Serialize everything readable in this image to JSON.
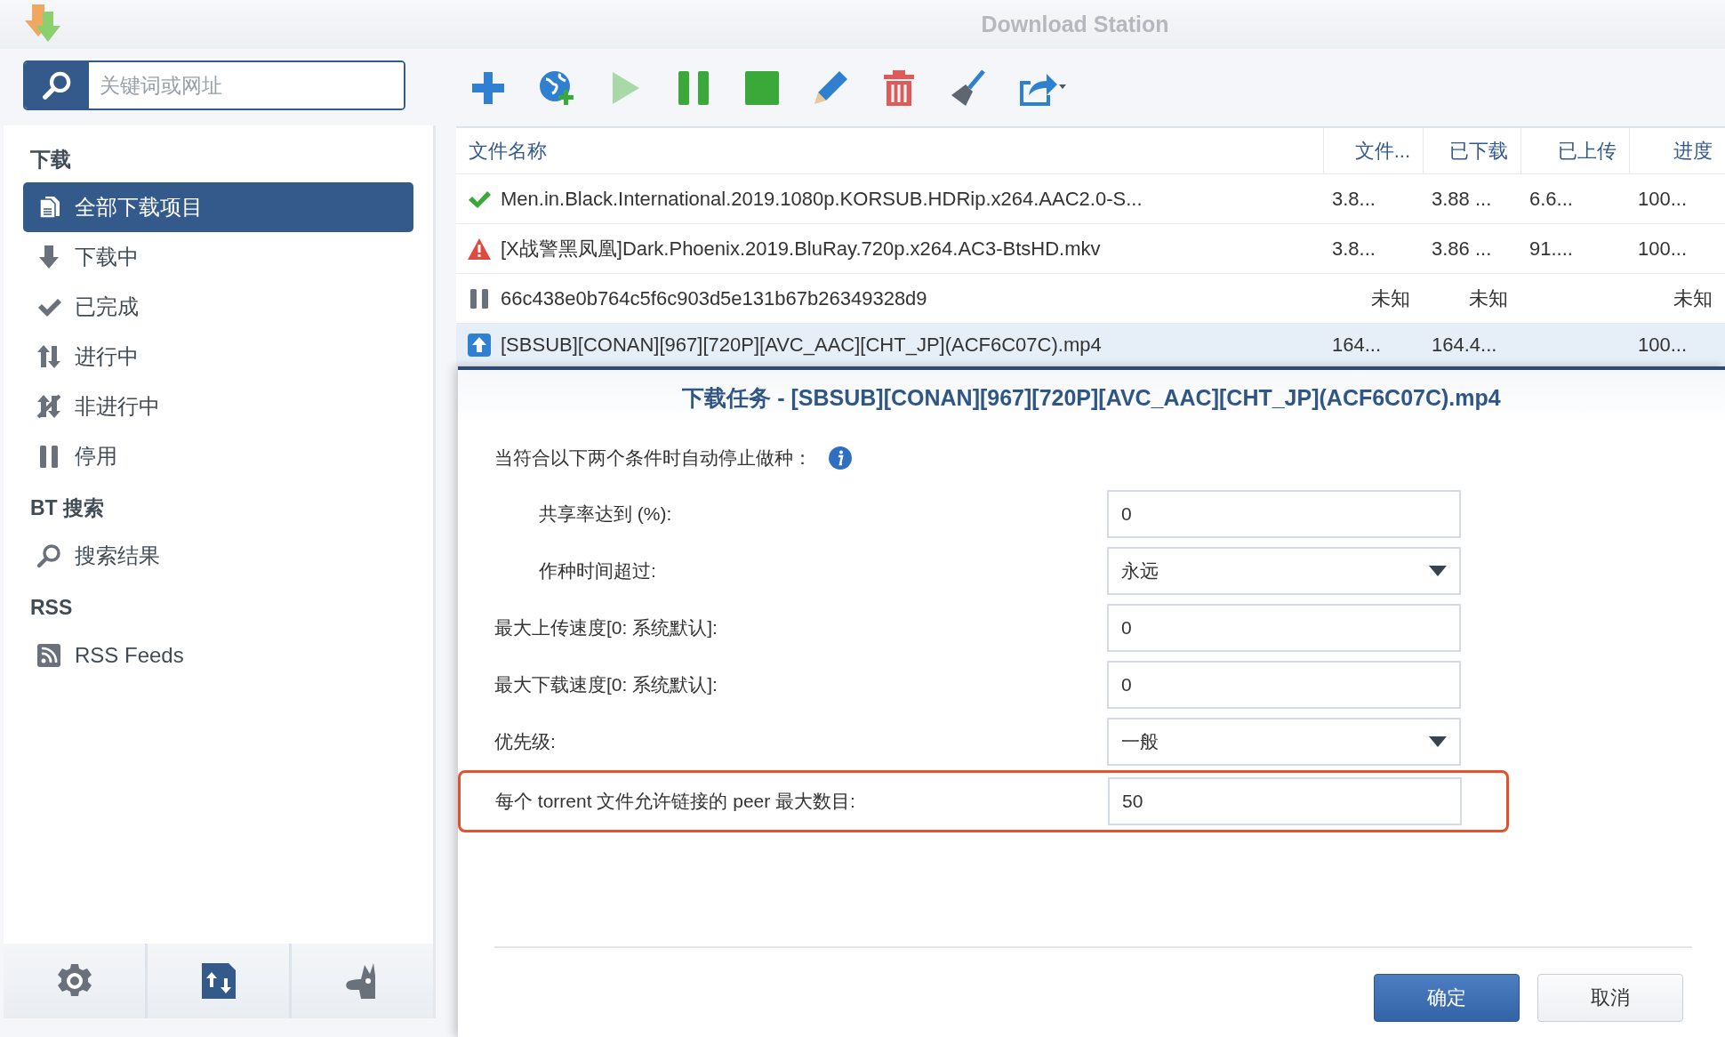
{
  "window": {
    "title": "Download Station"
  },
  "search": {
    "placeholder": "关键词或网址"
  },
  "sidebar": {
    "sections": [
      {
        "title": "下载",
        "items": [
          {
            "label": "全部下载项目",
            "kind": "all",
            "selected": true
          },
          {
            "label": "下载中",
            "kind": "downloading",
            "selected": false
          },
          {
            "label": "已完成",
            "kind": "completed",
            "selected": false
          },
          {
            "label": "进行中",
            "kind": "active",
            "selected": false
          },
          {
            "label": "非进行中",
            "kind": "inactive",
            "selected": false
          },
          {
            "label": "停用",
            "kind": "stopped",
            "selected": false
          }
        ]
      },
      {
        "title": "BT 搜索",
        "items": [
          {
            "label": "搜索结果",
            "kind": "search",
            "selected": false
          }
        ]
      },
      {
        "title": "RSS",
        "items": [
          {
            "label": "RSS Feeds",
            "kind": "rss",
            "selected": false
          }
        ]
      }
    ]
  },
  "toolbar": [
    {
      "kind": "add",
      "disabled": false
    },
    {
      "kind": "url",
      "disabled": false
    },
    {
      "kind": "play",
      "disabled": true
    },
    {
      "kind": "pause",
      "disabled": false
    },
    {
      "kind": "stop",
      "disabled": false
    },
    {
      "kind": "edit",
      "disabled": false
    },
    {
      "kind": "delete",
      "disabled": false
    },
    {
      "kind": "clean",
      "disabled": false
    },
    {
      "kind": "share",
      "disabled": false
    }
  ],
  "table": {
    "columns": [
      "文件名称",
      "文件...",
      "已下载",
      "已上传",
      "进度"
    ],
    "rows": [
      {
        "kind": "done",
        "name": "Men.in.Black.International.2019.1080p.KORSUB.HDRip.x264.AAC2.0-S...",
        "size": "3.8...",
        "downloaded": "3.88 ...",
        "uploaded": "6.6...",
        "progress": "100...",
        "selected": false
      },
      {
        "kind": "error",
        "name": "[X战警黑凤凰]Dark.Phoenix.2019.BluRay.720p.x264.AC3-BtsHD.mkv",
        "size": "3.8...",
        "downloaded": "3.86 ...",
        "uploaded": "91....",
        "progress": "100...",
        "selected": false
      },
      {
        "kind": "paused",
        "name": "66c438e0b764c5f6c903d5e131b67b26349328d9",
        "size": "未知",
        "downloaded": "未知",
        "progress": "未知",
        "selected": false
      },
      {
        "kind": "seeding",
        "name": "[SBSUB][CONAN][967][720P][AVC_AAC][CHT_JP](ACF6C07C).mp4",
        "size": "164...",
        "downloaded": "164.4...",
        "progress": "100...",
        "selected": true
      }
    ]
  },
  "dialog": {
    "title": "下载任务 - [SBSUB][CONAN][967][720P][AVC_AAC][CHT_JP](ACF6C07C).mp4",
    "intro": {
      "label": "当符合以下两个条件时自动停止做种：",
      "children": [
        {
          "label": "共享率达到 (%):",
          "value": "0",
          "kind": "text"
        },
        {
          "label": "作种时间超过:",
          "value": "永远",
          "kind": "select"
        }
      ]
    },
    "fields": [
      {
        "label": "最大上传速度[0: 系统默认]:",
        "value": "0",
        "kind": "text",
        "highlighted": false
      },
      {
        "label": "最大下载速度[0: 系统默认]:",
        "value": "0",
        "kind": "text",
        "highlighted": false
      },
      {
        "label": "优先级:",
        "value": "一般",
        "kind": "select",
        "highlighted": false
      },
      {
        "label": "每个 torrent 文件允许链接的 peer 最大数目:",
        "value": "50",
        "kind": "text",
        "highlighted": true
      }
    ],
    "buttons": [
      {
        "label": "确定",
        "kind": "primary"
      },
      {
        "label": "取消",
        "kind": "secondary"
      }
    ]
  }
}
